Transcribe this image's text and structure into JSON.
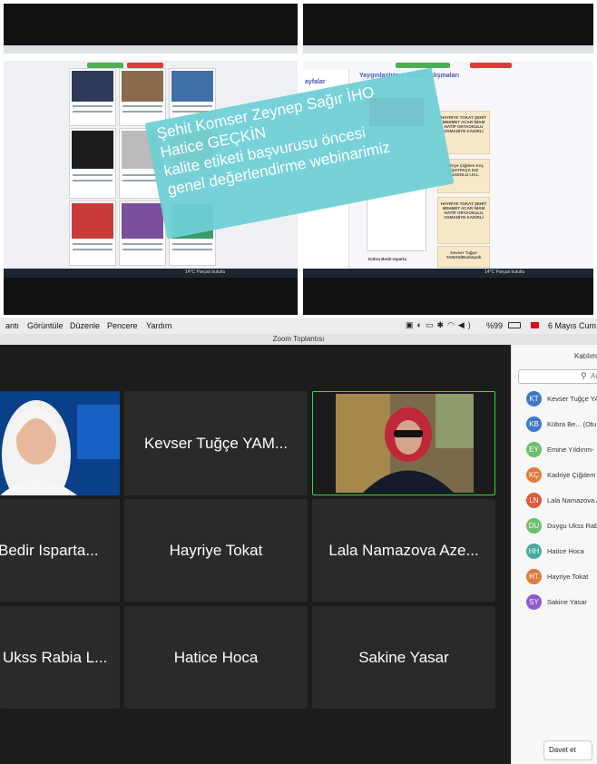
{
  "overlay": {
    "line1": "Şehit Komser Zeynep Sağır İHO",
    "line2": "Hatice GEÇKİN",
    "line3": "kalite etiketi başvurusu öncesi",
    "line4": "genel değerlendirme webinarimiz"
  },
  "right_shot": {
    "panel_title": "Yaygınlaştırma (EBA) Çalışmaları",
    "left_menu_label": "ayfalar",
    "cards": [
      {
        "title": "HAYRİYE TOKAT ŞEHİT MEHMET ACAR İMAM HATİP ORTAOKULU OSMANİYE KADİRLİ",
        "sub": "EBA PAYLAŞIMLARIMIZ"
      },
      {
        "title": "Kadriye Çiğdem Koç EŞATPAŞA KIZ ANADOLU İ.H.L.",
        "sub": "EBA Paylaşımları"
      },
      {
        "title": "HAYRİYE TOKAT ŞEHİT MEHMET ACAR İMAM HATİP ORTAOKULU OSMANİYE KADİRLİ",
        "sub": "YAYGINLAŞTIRMA OKUL WEB SİTESİ"
      },
      {
        "title": "Kevser Tuğçe YAMAN/Bozhüyük",
        "sub": ""
      }
    ],
    "bottom_label": "Kübra Bedir-Isparta"
  },
  "taskbar": {
    "weather": "14°C Parçalı bulutlu"
  },
  "menubar": {
    "items": [
      "antı",
      "Görüntüle",
      "Düzenle",
      "Pencere",
      "Yardım"
    ],
    "battery": "%99",
    "date": "6 Mayıs Cum"
  },
  "zoom": {
    "window_title": "Zoom Toplantısı",
    "tiles": [
      {
        "name": ""
      },
      {
        "name": "Kevser Tuğçe YAM..."
      },
      {
        "name": ""
      },
      {
        "name": "Bedir Isparta..."
      },
      {
        "name": "Hayriye Tokat"
      },
      {
        "name": "Lala Namazova Aze..."
      },
      {
        "name": "Ukss Rabia L..."
      },
      {
        "name": "Hatice Hoca"
      },
      {
        "name": "Sakine Yasar"
      }
    ],
    "panel": {
      "title": "Katılım",
      "search_placeholder": "Ar",
      "invite_label": "Davet et",
      "participants": [
        {
          "initials": "KT",
          "name": "Kevser Tuğçe YA",
          "color": "#3f78c9"
        },
        {
          "initials": "KB",
          "name": "Kübra Be... (Otu",
          "color": "#3f78c9"
        },
        {
          "initials": "EY",
          "name": "Emine Yıldırım-",
          "color": "#6cbf6c"
        },
        {
          "initials": "KÇ",
          "name": "Kadriye Çiğdem",
          "color": "#e07a3a"
        },
        {
          "initials": "LN",
          "name": "Lala Namazova A",
          "color": "#e05a3a"
        },
        {
          "initials": "DU",
          "name": "Duygu Ukss Rab",
          "color": "#6cbf6c"
        },
        {
          "initials": "HH",
          "name": "Hatice Hoca",
          "color": "#4aa7a0"
        },
        {
          "initials": "HT",
          "name": "Hayriye Tokat",
          "color": "#e07a3a"
        },
        {
          "initials": "SY",
          "name": "Sakine Yasar",
          "color": "#8b5bd0"
        }
      ]
    }
  }
}
